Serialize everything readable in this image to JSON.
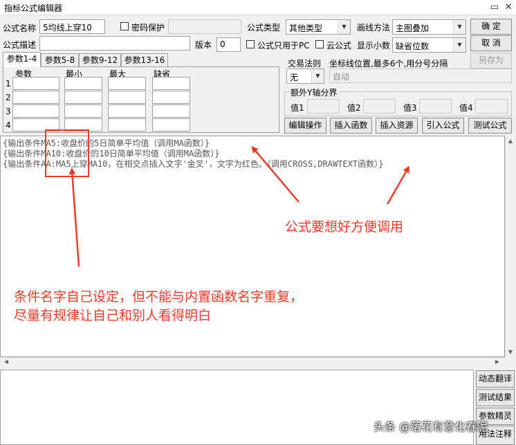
{
  "window": {
    "title": "指标公式编辑器",
    "minimize": "▭",
    "close": "✕"
  },
  "form": {
    "name_label": "公式名称",
    "name_value": "5均线上穿10",
    "password_label": "密码保护",
    "desc_label": "公式描述",
    "version_label": "版本",
    "version_value": "0",
    "type_label": "公式类型",
    "type_value": "其他类型",
    "draw_label": "画线方法",
    "draw_value": "主图叠加",
    "pc_only_label": "公式只用于PC",
    "cloud_label": "云公式",
    "decimals_label": "显示小数",
    "decimals_value": "缺省位数"
  },
  "buttons": {
    "ok": "确  定",
    "cancel": "取  消",
    "save_as": "另存为",
    "edit_ops": "编辑操作",
    "insert_func": "插入函数",
    "insert_res": "插入资源",
    "import": "引入公式",
    "test": "测试公式"
  },
  "tabs": [
    "参数1-4",
    "参数5-8",
    "参数9-12",
    "参数13-16"
  ],
  "params": {
    "headers": [
      "参数",
      "最小",
      "最大",
      "缺省"
    ],
    "rows": [
      "1",
      "2",
      "3",
      "4"
    ]
  },
  "trade": {
    "label": "交易法则",
    "value": "无",
    "coord_label": "坐标线位置,最多6个,用分号分隔",
    "coord_placeholder": "自动"
  },
  "yaxis": {
    "legend": "额外Y轴分界",
    "labels": [
      "值1",
      "值2",
      "值3",
      "值4"
    ]
  },
  "code_lines": [
    "{输出条件MA5:收盘价的5日简单平均值（调用MA函数）}",
    "{输出条件MA10:收盘价的10日简单平均值（调用MA函数）}",
    "{输出条件AA:MA5上穿MA10，在相交点插入文字'金叉'，文字为红色。（调用CROSS,DRAWTEXT函数）}"
  ],
  "side_buttons": [
    "动态翻译",
    "测试结果",
    "参数精灵",
    "用法注释"
  ],
  "annotations": {
    "formula_note": "公式要想好方便调用",
    "condition_note_1": "条件名字自己设定，但不能与内置函数名字重复，",
    "condition_note_2": "尽量有规律让自己和别人看得明白"
  },
  "watermark": "头条 @落花有意化春泥",
  "colors": {
    "annotation": "#f03a28"
  }
}
